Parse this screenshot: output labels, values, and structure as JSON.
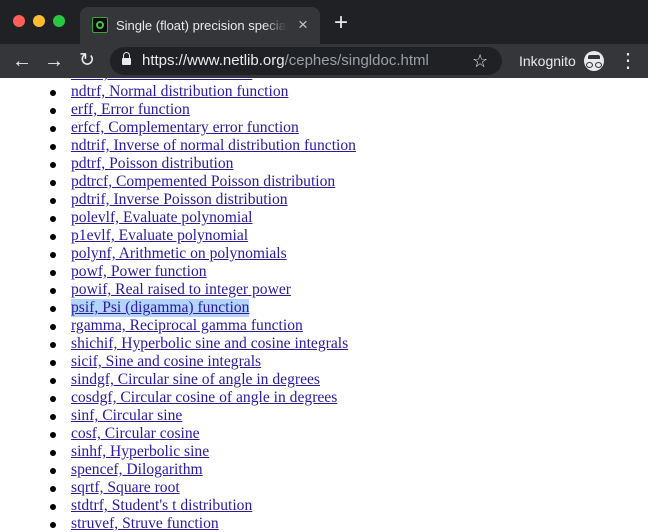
{
  "window": {
    "tab_title": "Single (float) precision special functions",
    "tab_close": "×",
    "new_tab": "+"
  },
  "toolbar": {
    "back": "←",
    "forward": "→",
    "reload": "↻",
    "url_host": "https://www.netlib.org",
    "url_path": "/cephes/singldoc.html",
    "bookmark": "☆",
    "incognito_label": "Inkognito",
    "menu": "⋮"
  },
  "functions": [
    {
      "text": "stdtrf, Student's t distribution"
    },
    {
      "text": "ndtrf, Normal distribution function"
    },
    {
      "text": "erff, Error function"
    },
    {
      "text": "erfcf, Complementary error function"
    },
    {
      "text": "ndtrif, Inverse of normal distribution function"
    },
    {
      "text": "pdtrf, Poisson distribution"
    },
    {
      "text": "pdtrcf, Compemented Poisson distribution"
    },
    {
      "text": "pdtrif, Inverse Poisson distribution"
    },
    {
      "text": "polevlf, Evaluate polynomial"
    },
    {
      "text": "p1evlf, Evaluate polynomial"
    },
    {
      "text": "polynf, Arithmetic on polynomials"
    },
    {
      "text": "powf, Power function"
    },
    {
      "text": "powif, Real raised to integer power"
    },
    {
      "text": "psif, Psi (digamma) function",
      "selected": true
    },
    {
      "text": "rgamma, Reciprocal gamma function"
    },
    {
      "text": "shichif, Hyperbolic sine and cosine integrals"
    },
    {
      "text": "sicif, Sine and cosine integrals"
    },
    {
      "text": "sindgf, Circular sine of angle in degrees"
    },
    {
      "text": "cosdgf, Circular cosine of angle in degrees"
    },
    {
      "text": "sinf, Circular sine"
    },
    {
      "text": "cosf, Circular cosine"
    },
    {
      "text": "sinhf, Hyperbolic sine"
    },
    {
      "text": "spencef, Dilogarithm"
    },
    {
      "text": "sqrtf, Square root"
    },
    {
      "text": "stdtrf, Student's t distribution"
    },
    {
      "text": "struvef, Struve function"
    }
  ]
}
